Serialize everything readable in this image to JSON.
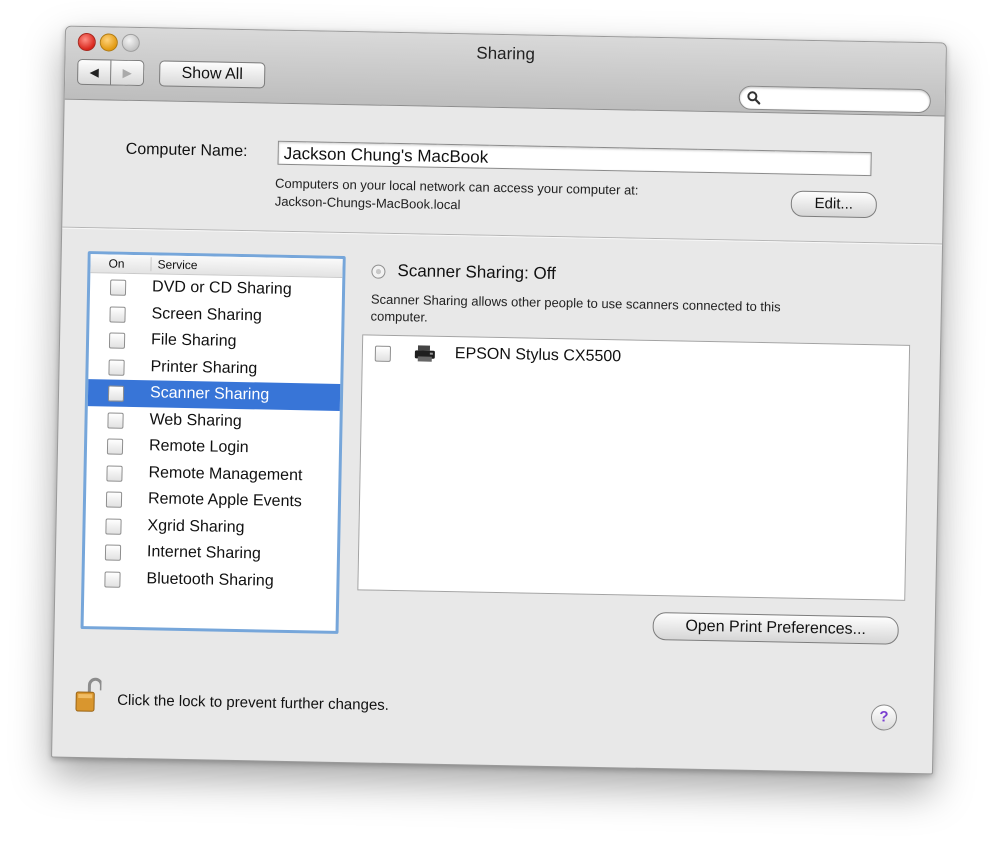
{
  "window": {
    "title": "Sharing",
    "nav": {
      "back_glyph": "◀",
      "forward_glyph": "▶"
    },
    "show_all_label": "Show All",
    "search": {
      "placeholder": "",
      "icon": "search-icon"
    }
  },
  "computer_name": {
    "label": "Computer Name:",
    "value": "Jackson Chung's MacBook",
    "info_line1": "Computers on your local network can access your computer at:",
    "info_line2": "Jackson-Chungs-MacBook.local",
    "edit_label": "Edit..."
  },
  "services": {
    "header_on": "On",
    "header_service": "Service",
    "items": [
      {
        "label": "DVD or CD Sharing",
        "checked": false
      },
      {
        "label": "Screen Sharing",
        "checked": false
      },
      {
        "label": "File Sharing",
        "checked": false
      },
      {
        "label": "Printer Sharing",
        "checked": false
      },
      {
        "label": "Scanner Sharing",
        "checked": false,
        "selected": true
      },
      {
        "label": "Web Sharing",
        "checked": false
      },
      {
        "label": "Remote Login",
        "checked": false
      },
      {
        "label": "Remote Management",
        "checked": false
      },
      {
        "label": "Remote Apple Events",
        "checked": false
      },
      {
        "label": "Xgrid Sharing",
        "checked": false
      },
      {
        "label": "Internet Sharing",
        "checked": false
      },
      {
        "label": "Bluetooth Sharing",
        "checked": false
      }
    ]
  },
  "detail": {
    "status": "Scanner Sharing: Off",
    "desc_line1": "Scanner Sharing allows other people to use scanners connected to this",
    "desc_line2": "computer.",
    "scanners": [
      {
        "label": "EPSON Stylus CX5500",
        "checked": false,
        "icon": "printer-icon"
      }
    ],
    "open_print_label": "Open Print Preferences..."
  },
  "footer": {
    "lock_text": "Click the lock to prevent further changes.",
    "help_glyph": "?"
  },
  "colors": {
    "selection": "#3875d7",
    "focus_ring": "#76a6da",
    "close": "#d9261c",
    "minimize": "#e29a12"
  }
}
